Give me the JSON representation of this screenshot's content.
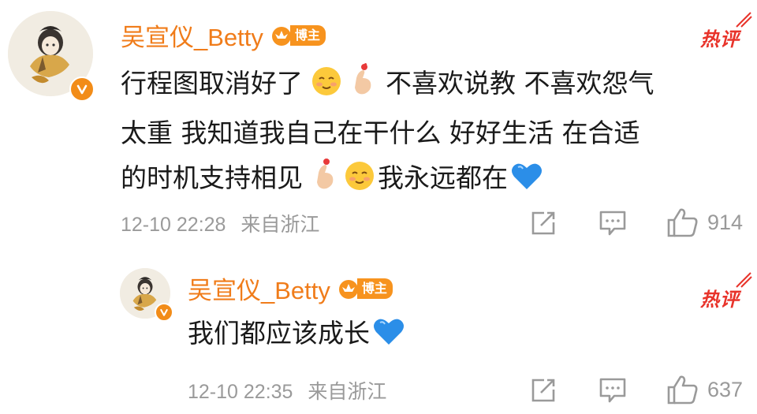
{
  "comments": [
    {
      "username": "吴宣仪_Betty",
      "role_badge": "博主",
      "hot_label": "热评",
      "lines": [
        "行程图取消好了",
        "不喜欢说教 不喜欢怨气",
        "太重 我知道我自己在干什么 好好生活 在合适",
        "的时机支持相见",
        "我永远都在"
      ],
      "timestamp": "12-10 22:28",
      "location": "来自浙江",
      "likes": "914"
    },
    {
      "username": "吴宣仪_Betty",
      "role_badge": "博主",
      "hot_label": "热评",
      "lines": [
        "我们都应该成长"
      ],
      "timestamp": "12-10 22:35",
      "location": "来自浙江",
      "likes": "637"
    }
  ],
  "icons": {
    "share": "share-icon",
    "comment": "comment-icon",
    "like": "thumbs-up-icon",
    "verified": "verified-badge-icon",
    "crown": "crown-icon",
    "emoji_blush": "blushing-face-emoji",
    "emoji_heart_hand": "finger-heart-emoji",
    "emoji_blue_heart": "blue-heart-emoji"
  },
  "colors": {
    "username": "#f07c1a",
    "hot": "#e8332a",
    "meta": "#9a9a9a",
    "badge": "#f7931e",
    "text": "#1a1a1a"
  }
}
